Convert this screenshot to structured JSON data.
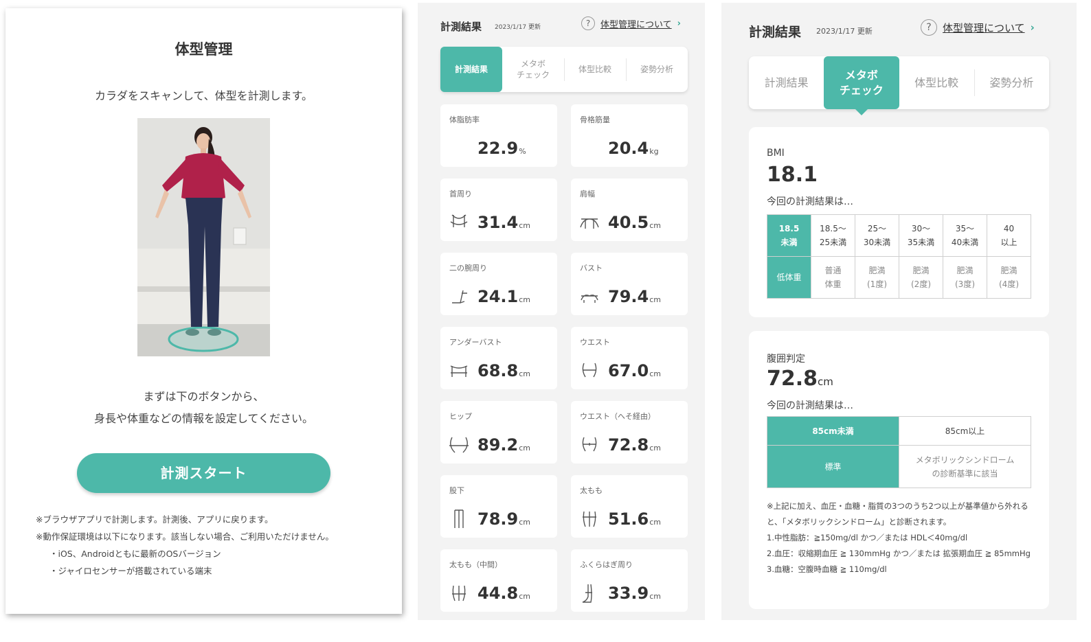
{
  "panel1": {
    "title": "体型管理",
    "lead": "カラダをスキャンして、体型を計測します。",
    "intro_line1": "まずは下のボタンから、",
    "intro_line2": "身長や体重などの情報を設定してください。",
    "start_button": "計測スタート",
    "notes": [
      "※ブラウザアプリで計測します。計測後、アプリに戻ります。",
      "※動作保証環境は以下になります。該当しない場合、ご利用いただけません。",
      "・iOS、Androidともに最新のOSバージョン",
      "・ジャイロセンサーが搭載されている端末"
    ]
  },
  "panel2": {
    "header": "計測結果",
    "date": "2023/1/17 更新",
    "help_text": "体型管理について",
    "tabs": [
      "計測結果",
      "メタボ\nチェック",
      "体型比較",
      "姿勢分析"
    ],
    "cards": [
      {
        "label": "体脂肪率",
        "value": "22.9",
        "unit": "%",
        "icon": ""
      },
      {
        "label": "骨格筋量",
        "value": "20.4",
        "unit": "kg",
        "icon": ""
      },
      {
        "label": "首周り",
        "value": "31.4",
        "unit": "cm",
        "icon": "neck-icon"
      },
      {
        "label": "肩幅",
        "value": "40.5",
        "unit": "cm",
        "icon": "shoulder-icon"
      },
      {
        "label": "二の腕周り",
        "value": "24.1",
        "unit": "cm",
        "icon": "arm-icon"
      },
      {
        "label": "バスト",
        "value": "79.4",
        "unit": "cm",
        "icon": "bust-icon"
      },
      {
        "label": "アンダーバスト",
        "value": "68.8",
        "unit": "cm",
        "icon": "underbust-icon"
      },
      {
        "label": "ウエスト",
        "value": "67.0",
        "unit": "cm",
        "icon": "waist-icon"
      },
      {
        "label": "ヒップ",
        "value": "89.2",
        "unit": "cm",
        "icon": "hip-icon"
      },
      {
        "label": "ウエスト（へそ経由）",
        "value": "72.8",
        "unit": "cm",
        "icon": "navel-waist-icon"
      },
      {
        "label": "股下",
        "value": "78.9",
        "unit": "cm",
        "icon": "inseam-icon"
      },
      {
        "label": "太もも",
        "value": "51.6",
        "unit": "cm",
        "icon": "thigh-icon"
      },
      {
        "label": "太もも（中間）",
        "value": "44.8",
        "unit": "cm",
        "icon": "mid-thigh-icon"
      },
      {
        "label": "ふくらはぎ周り",
        "value": "33.9",
        "unit": "cm",
        "icon": "calf-icon"
      }
    ]
  },
  "panel3": {
    "header": "計測結果",
    "date": "2023/1/17 更新",
    "help_text": "体型管理について",
    "tabs": [
      "計測結果",
      "メタボ\nチェック",
      "体型比較",
      "姿勢分析"
    ],
    "bmi": {
      "label": "BMI",
      "value": "18.1",
      "sub": "今回の計測結果は…",
      "ranges": [
        "18.5\n未満",
        "18.5〜\n25未満",
        "25〜\n30未満",
        "30〜\n35未満",
        "35〜\n40未満",
        "40\n以上"
      ],
      "categories": [
        "低体重",
        "普通\n体重",
        "肥満\n(1度)",
        "肥満\n(2度)",
        "肥満\n(3度)",
        "肥満\n(4度)"
      ]
    },
    "waist": {
      "label": "腹囲判定",
      "value": "72.8",
      "unit": "cm",
      "sub": "今回の計測結果は…",
      "ranges": [
        "85cm未満",
        "85cm以上"
      ],
      "judgements": [
        "標準",
        "メタボリックシンドローム\nの診断基準に該当"
      ]
    },
    "fine_print": [
      "※上記に加え、血圧・血糖・脂質の3つのうち2つ以上が基準値から外れると、「メタボリックシンドローム」と診断されます。",
      "1.中性脂肪：≧150mg/dl かつ／または HDL＜40mg/dl",
      "2.血圧：収縮期血圧 ≧ 130mmHg かつ／または 拡張期血圧 ≧ 85mmHg",
      "3.血糖：空腹時血糖 ≧ 110mg/dl"
    ]
  },
  "colors": {
    "accent": "#4db8a9",
    "background": "#f3f3f3"
  }
}
